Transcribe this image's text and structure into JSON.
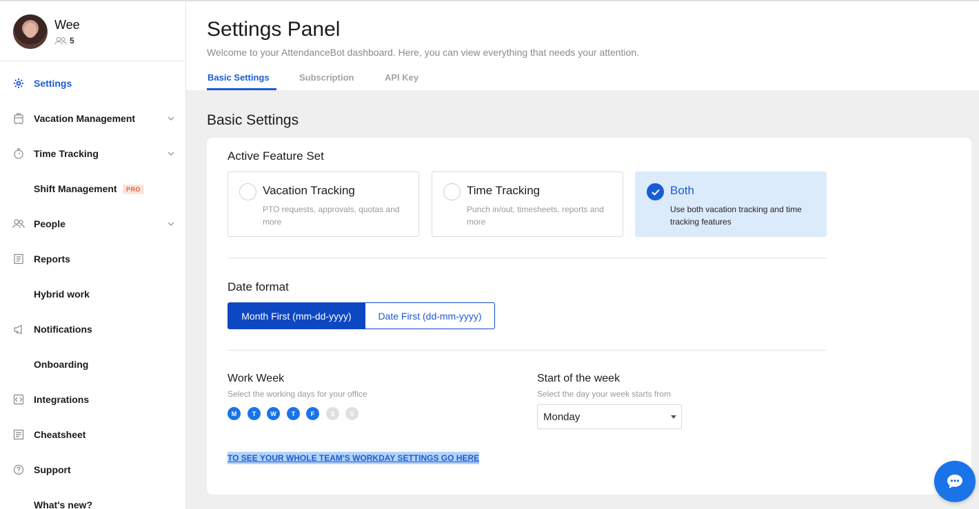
{
  "profile": {
    "name": "Wee",
    "team_count": "5"
  },
  "sidebar": {
    "items": [
      {
        "label": "Settings",
        "icon": "gear-icon",
        "active": true
      },
      {
        "label": "Vacation Management",
        "icon": "suitcase-icon",
        "expandable": true
      },
      {
        "label": "Time Tracking",
        "icon": "stopwatch-icon",
        "expandable": true
      },
      {
        "label": "Shift Management",
        "badge": "PRO"
      },
      {
        "label": "People",
        "icon": "people-icon",
        "expandable": true
      },
      {
        "label": "Reports",
        "icon": "report-icon"
      },
      {
        "label": "Hybrid work"
      },
      {
        "label": "Notifications",
        "icon": "megaphone-icon"
      },
      {
        "label": "Onboarding"
      },
      {
        "label": "Integrations",
        "icon": "integrations-icon"
      },
      {
        "label": "Cheatsheet",
        "icon": "cheatsheet-icon"
      },
      {
        "label": "Support",
        "icon": "question-icon"
      },
      {
        "label": "What's new?"
      }
    ]
  },
  "header": {
    "title": "Settings Panel",
    "subtitle": "Welcome to your AttendanceBot dashboard. Here, you can view everything that needs your attention.",
    "tabs": [
      {
        "label": "Basic Settings",
        "active": true
      },
      {
        "label": "Subscription"
      },
      {
        "label": "API Key"
      }
    ]
  },
  "main": {
    "section_title": "Basic Settings",
    "feature_set": {
      "label": "Active Feature Set",
      "options": [
        {
          "title": "Vacation Tracking",
          "desc": "PTO requests, approvals, quotas and more",
          "selected": false
        },
        {
          "title": "Time Tracking",
          "desc": "Punch in/out, timesheets, reports and more",
          "selected": false
        },
        {
          "title": "Both",
          "desc": "Use both vacation tracking and time tracking features",
          "selected": true
        }
      ]
    },
    "date_format": {
      "label": "Date format",
      "options": [
        {
          "label": "Month First (mm-dd-yyyy)",
          "selected": true
        },
        {
          "label": "Date First (dd-mm-yyyy)",
          "selected": false
        }
      ]
    },
    "work_week": {
      "label": "Work Week",
      "sub": "Select the working days for your office",
      "days": [
        {
          "letter": "M",
          "on": true
        },
        {
          "letter": "T",
          "on": true
        },
        {
          "letter": "W",
          "on": true
        },
        {
          "letter": "T",
          "on": true
        },
        {
          "letter": "F",
          "on": true
        },
        {
          "letter": "S",
          "on": false
        },
        {
          "letter": "S",
          "on": false
        }
      ]
    },
    "week_start": {
      "label": "Start of the week",
      "sub": "Select the day your week starts from",
      "value": "Monday"
    },
    "team_link": "TO SEE YOUR WHOLE TEAM'S WORKDAY SETTINGS GO HERE"
  },
  "colors": {
    "accent": "#1a5bd6",
    "primary_dark": "#0d47c2",
    "selected_bg": "#dcebfb",
    "pro_badge": "#e2623b"
  }
}
